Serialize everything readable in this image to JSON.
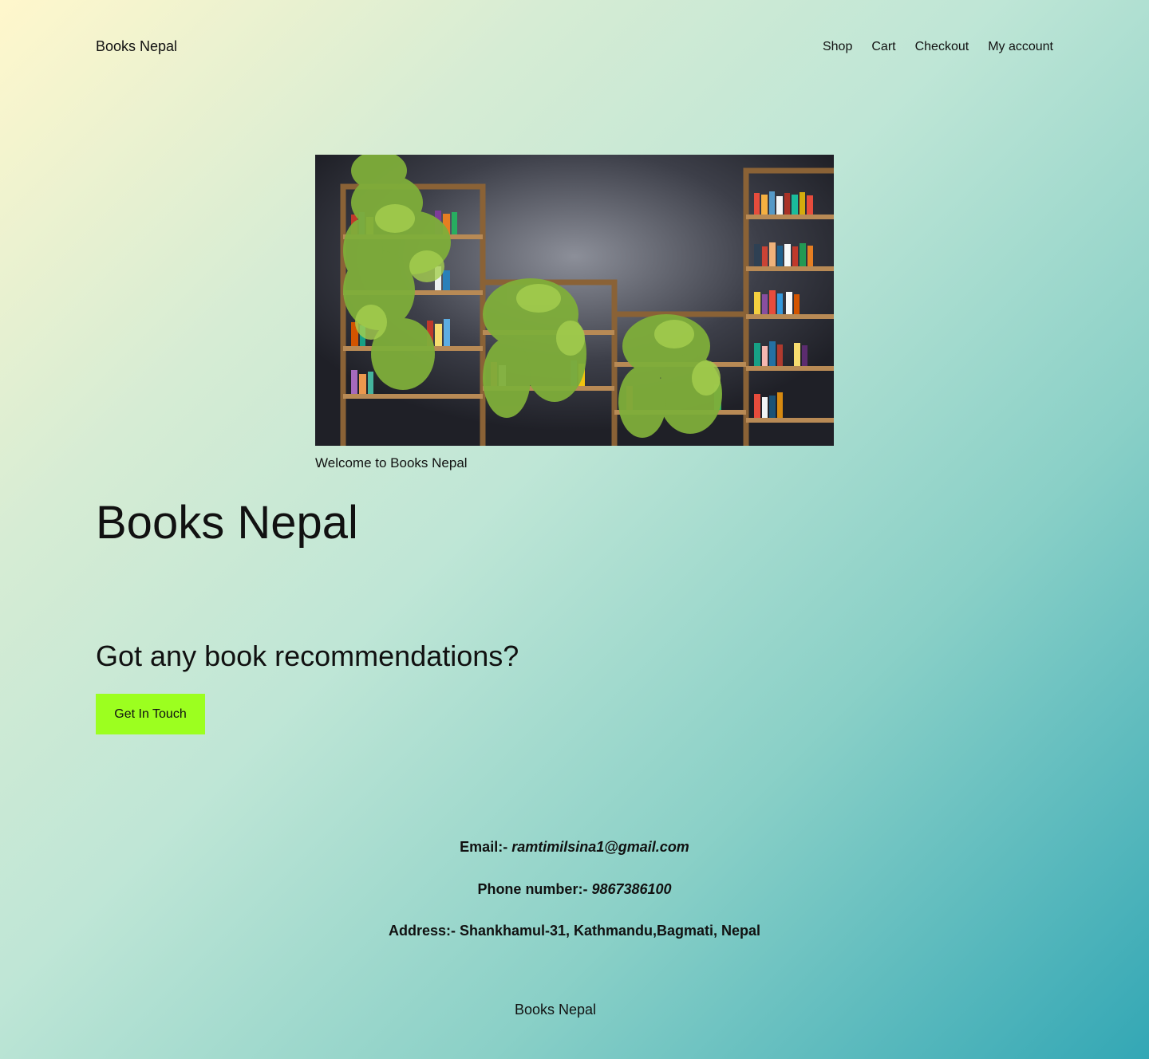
{
  "header": {
    "site_title": "Books Nepal",
    "nav": [
      "Shop",
      "Cart",
      "Checkout",
      "My account"
    ]
  },
  "hero": {
    "image_alt": "bookshelves with plants",
    "caption": "Welcome to Books Nepal"
  },
  "main": {
    "title": "Books Nepal",
    "question": "Got any book recommendations?",
    "cta_label": "Get In Touch"
  },
  "contact": {
    "email_label": "Email:- ",
    "email_value": "ramtimilsina1@gmail.com",
    "phone_label": "Phone number:- ",
    "phone_value": "9867386100",
    "address_label": "Address:- ",
    "address_value": "Shankhamul-31, Kathmandu,Bagmati, Nepal"
  },
  "footer": {
    "site_title": "Books Nepal"
  },
  "colors": {
    "accent": "#9cff1f",
    "gradient_start": "#fff7cc",
    "gradient_end": "#33a7b5"
  }
}
